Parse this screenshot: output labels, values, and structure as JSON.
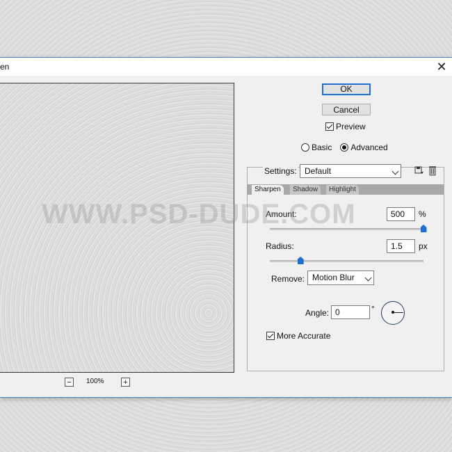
{
  "window": {
    "title": "en"
  },
  "preview": {
    "zoom_out": "−",
    "zoom_in": "+",
    "zoom_level": "100%"
  },
  "buttons": {
    "ok": "OK",
    "cancel": "Cancel"
  },
  "preview_toggle": {
    "label": "Preview",
    "checked": true
  },
  "mode": {
    "basic_label": "Basic",
    "advanced_label": "Advanced",
    "selected": "Advanced"
  },
  "settings": {
    "label": "Settings:",
    "value": "Default"
  },
  "tabs": [
    {
      "label": "Sharpen",
      "active": true
    },
    {
      "label": "Shadow"
    },
    {
      "label": "Highlight"
    }
  ],
  "amount": {
    "label": "Amount:",
    "value": "500",
    "unit": "%",
    "level_percent": 100
  },
  "radius": {
    "label": "Radius:",
    "value": "1.5",
    "unit": "px",
    "level_percent": 20
  },
  "remove": {
    "label": "Remove:",
    "value": "Motion Blur"
  },
  "angle": {
    "label": "Angle:",
    "value": "0",
    "unit": "°"
  },
  "more_accurate": {
    "label": "More Accurate",
    "checked": true
  },
  "watermark": {
    "text": "WWW.PSD-DUDE.COM"
  }
}
